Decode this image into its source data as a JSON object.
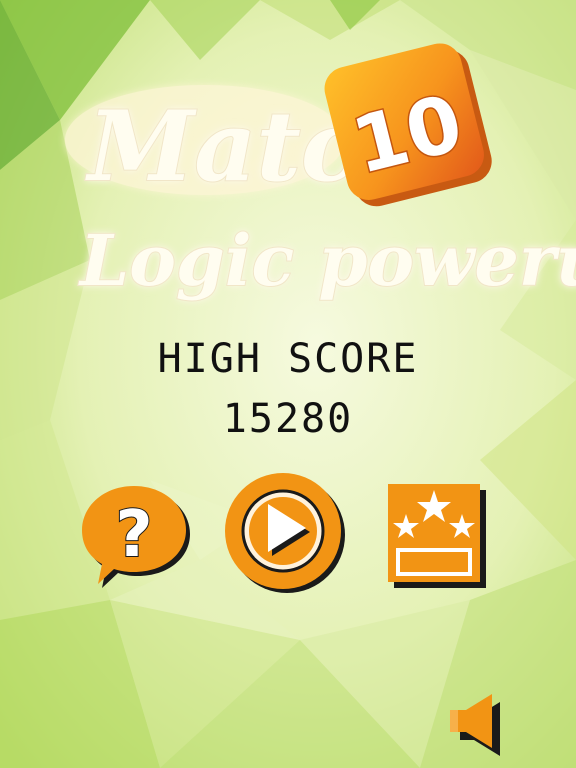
{
  "game": {
    "title_line1": "Match",
    "badge_number": "10",
    "title_line2": "Logic powerup"
  },
  "high_score": {
    "label": "HIGH SCORE",
    "value": "15280"
  },
  "buttons": {
    "help": {
      "icon": "question-mark-icon"
    },
    "play": {
      "icon": "play-icon"
    },
    "rating": {
      "icon": "stars-icon"
    },
    "sound": {
      "icon": "speaker-icon"
    }
  },
  "colors": {
    "accent": "#f29414",
    "accent_dark": "#d9780a",
    "icon_white": "#ffffff",
    "shadow": "#1a1a1a",
    "background_light": "#eef6c8",
    "background_green": "#8cc63f"
  }
}
